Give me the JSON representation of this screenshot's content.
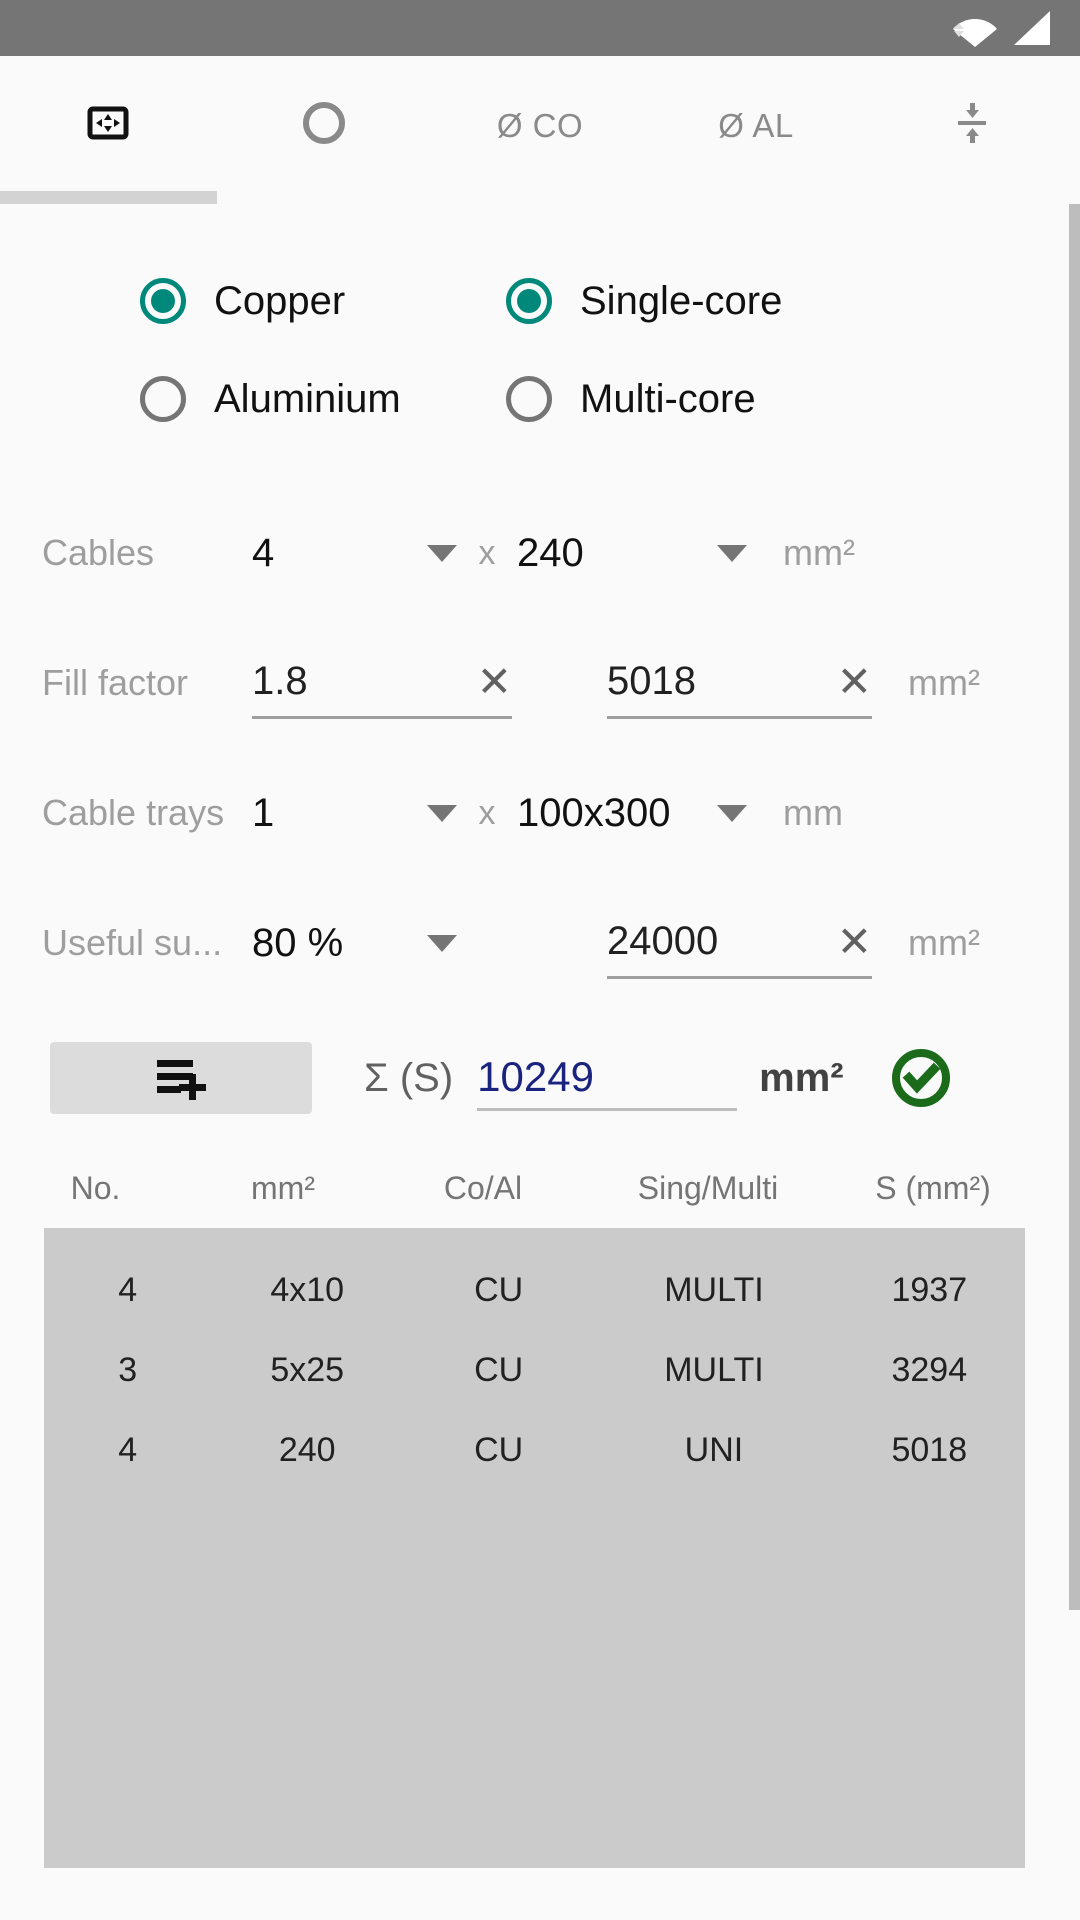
{
  "statusbar": {
    "icons": [
      "wifi-icon",
      "cellular-signal-icon"
    ]
  },
  "tabs": [
    {
      "id": "tab-tray-section",
      "icon": "rectangle-expand-icon",
      "label": "",
      "selected": true
    },
    {
      "id": "tab-conduit",
      "icon": "circle-outline-icon",
      "label": "",
      "selected": false
    },
    {
      "id": "tab-diameter-co",
      "icon": "",
      "label": "Ø CO",
      "selected": false
    },
    {
      "id": "tab-diameter-al",
      "icon": "",
      "label": "Ø AL",
      "selected": false
    },
    {
      "id": "tab-compress",
      "icon": "compress-vertical-icon",
      "label": "",
      "selected": false
    }
  ],
  "material": {
    "options": [
      {
        "label": "Copper",
        "selected": true
      },
      {
        "label": "Aluminium",
        "selected": false
      }
    ]
  },
  "core": {
    "options": [
      {
        "label": "Single-core",
        "selected": true
      },
      {
        "label": "Multi-core",
        "selected": false
      }
    ]
  },
  "rows": {
    "cables": {
      "label": "Cables",
      "count": "4",
      "separator": "x",
      "section": "240",
      "unit": "mm²"
    },
    "fill_factor": {
      "label": "Fill factor",
      "factor": "1.8",
      "area": "5018",
      "unit": "mm²",
      "clear": "✕"
    },
    "cable_trays": {
      "label": "Cable trays",
      "count": "1",
      "separator": "x",
      "size": "100x300",
      "unit": "mm"
    },
    "useful_surface": {
      "label": "Useful su...",
      "percent": "80 %",
      "value": "24000",
      "unit": "mm²",
      "clear": "✕"
    }
  },
  "sum": {
    "add_button_icon": "playlist-add-icon",
    "sigma_label": "Σ (S)",
    "total": "10249",
    "unit": "mm²",
    "status_icon": "check-circle-icon",
    "status_color": "#1b6b1b",
    "total_color": "#1a237e"
  },
  "table": {
    "headers": [
      "No.",
      "mm²",
      "Co/Al",
      "Sing/Multi",
      "S (mm²)"
    ],
    "rows": [
      {
        "no": "4",
        "mm2": "4x10",
        "coal": "CU",
        "singmulti": "MULTI",
        "s": "1937"
      },
      {
        "no": "3",
        "mm2": "5x25",
        "coal": "CU",
        "singmulti": "MULTI",
        "s": "3294"
      },
      {
        "no": "4",
        "mm2": "240",
        "coal": "CU",
        "singmulti": "UNI",
        "s": "5018"
      }
    ]
  },
  "colors": {
    "accent": "#00897b",
    "statusbar": "#757575",
    "background": "#fafafa",
    "table_bg": "#cbcbcb"
  }
}
